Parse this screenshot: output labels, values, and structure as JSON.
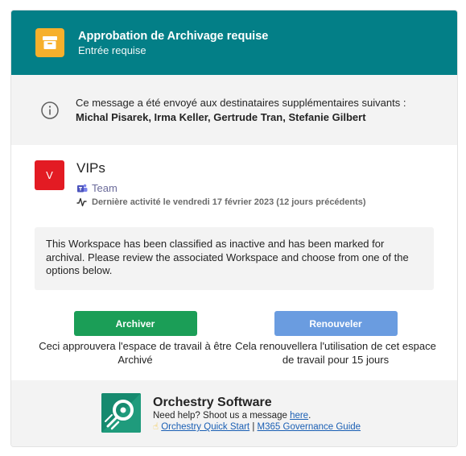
{
  "header": {
    "title": "Approbation de Archivage requise",
    "subtitle": "Entrée requise",
    "icon": "archive-box-icon",
    "bg_color": "#037f87",
    "icon_color": "#f6b02c"
  },
  "notice": {
    "icon": "info-icon",
    "prefix": "Ce message a été envoyé aux destinataires supplémentaires suivants : ",
    "recipients": "Michal Pisarek, Irma Keller, Gertrude Tran, Stefanie Gilbert"
  },
  "workspace": {
    "avatar_letter": "V",
    "avatar_color": "#e31b23",
    "name": "VIPs",
    "type": "Team",
    "type_icon": "teams-icon",
    "activity_icon": "activity-pulse-icon",
    "last_activity": "Dernière activité le vendredi 17 février 2023 (12 jours précédents)"
  },
  "description": "This Workspace has been classified as inactive and has been marked for archival. Please review the associated Workspace and choose from one of the options below.",
  "actions": {
    "archive_label": "Archiver",
    "archive_caption": "Ceci approuvera l'espace de travail à être Archivé",
    "archive_color": "#1b9e57",
    "renew_label": "Renouveler",
    "renew_caption": "Cela renouvellera l'utilisation de cet espace de travail pour 15 jours",
    "renew_color": "#6a9ce0"
  },
  "footer": {
    "logo": "orchestry-logo",
    "brand": "Orchestry Software",
    "help_prefix": "Need help? Shoot us a message ",
    "help_link": "here",
    "help_suffix": ".",
    "star_icon": "star-emoji-icon",
    "quick_start": "Orchestry Quick Start",
    "separator": "|",
    "governance_guide": "M365 Governance Guide"
  }
}
